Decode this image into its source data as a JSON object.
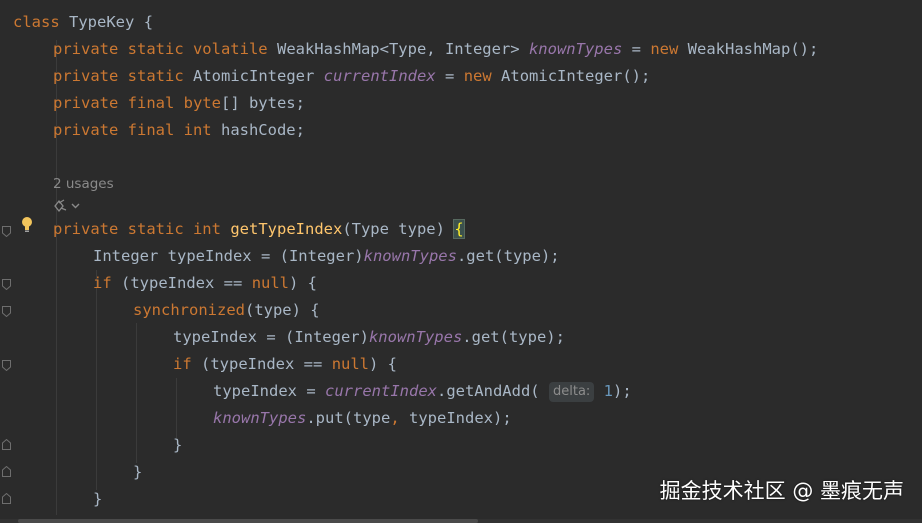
{
  "code": {
    "l1": {
      "kw": "class",
      "name": "TypeKey",
      "brace": "{"
    },
    "l2": {
      "kw": "private static volatile",
      "type": "WeakHashMap<Type, Integer>",
      "field": "knownTypes",
      "eq": "=",
      "kw_new": "new",
      "rest": "WeakHashMap();"
    },
    "l3": {
      "kw": "private static",
      "type": "AtomicInteger",
      "field": "currentIndex",
      "eq": "=",
      "kw_new": "new",
      "rest": "AtomicInteger();"
    },
    "l4": {
      "kw": "private final byte",
      "rest": "[] bytes;"
    },
    "l5": {
      "kw": "private final int",
      "rest": "hashCode;"
    },
    "usages": "2 usages",
    "l6": {
      "kw": "private static int",
      "fn": "getTypeIndex",
      "params": "(Type type)",
      "brace": "{"
    },
    "l7": {
      "pre": "Integer typeIndex = (Integer)",
      "field": "knownTypes",
      "post": ".get(type);"
    },
    "l8": {
      "kw": "if",
      "mid": "(typeIndex ==",
      "kw2": "null",
      "post": ") {"
    },
    "l9": {
      "kw": "synchronized",
      "post": "(type) {"
    },
    "l10": {
      "pre": "typeIndex = (Integer)",
      "field": "knownTypes",
      "post": ".get(type);"
    },
    "l11": {
      "kw": "if",
      "mid": "(typeIndex ==",
      "kw2": "null",
      "post": ") {"
    },
    "l12": {
      "pre": "typeIndex =",
      "field": "currentIndex",
      "call": ".getAndAdd(",
      "hint": "delta:",
      "num": "1",
      "post": ");"
    },
    "l13": {
      "field": "knownTypes",
      "call": ".put(type",
      "comma": ",",
      "post": "typeIndex);"
    },
    "l14": {
      "brace": "}"
    },
    "l15": {
      "brace": "}"
    },
    "l16": {
      "brace": "}"
    }
  },
  "watermark": "掘金技术社区 @ 墨痕无声",
  "colors": {
    "background": "#2b2b2b",
    "keyword": "#cc7832",
    "field": "#9876aa",
    "function": "#ffc66d",
    "text": "#a9b7c6",
    "number": "#6897bb"
  },
  "icons": {
    "bulb": "lightbulb-icon",
    "lens": "code-vision-icon"
  }
}
